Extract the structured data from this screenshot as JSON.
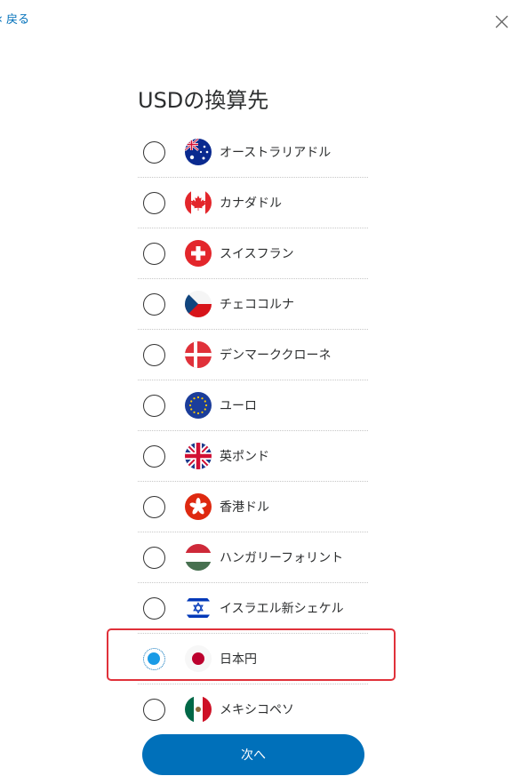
{
  "nav": {
    "back_label": "戻る"
  },
  "title": "USDの換算先",
  "currencies": [
    {
      "label": "オーストラリアドル",
      "flag": "australia-flag-icon",
      "selected": false
    },
    {
      "label": "カナダドル",
      "flag": "canada-flag-icon",
      "selected": false
    },
    {
      "label": "スイスフラン",
      "flag": "switzerland-flag-icon",
      "selected": false
    },
    {
      "label": "チェココルナ",
      "flag": "czech-flag-icon",
      "selected": false
    },
    {
      "label": "デンマーククローネ",
      "flag": "denmark-flag-icon",
      "selected": false
    },
    {
      "label": "ユーロ",
      "flag": "eu-flag-icon",
      "selected": false
    },
    {
      "label": "英ポンド",
      "flag": "uk-flag-icon",
      "selected": false
    },
    {
      "label": "香港ドル",
      "flag": "hongkong-flag-icon",
      "selected": false
    },
    {
      "label": "ハンガリーフォリント",
      "flag": "hungary-flag-icon",
      "selected": false
    },
    {
      "label": "イスラエル新シェケル",
      "flag": "israel-flag-icon",
      "selected": false
    },
    {
      "label": "日本円",
      "flag": "japan-flag-icon",
      "selected": true
    },
    {
      "label": "メキシコペソ",
      "flag": "mexico-flag-icon",
      "selected": false
    }
  ],
  "next_button": "次へ",
  "colors": {
    "accent": "#0070ba",
    "highlight": "#e0313a",
    "selected_dot": "#1a9be6"
  }
}
